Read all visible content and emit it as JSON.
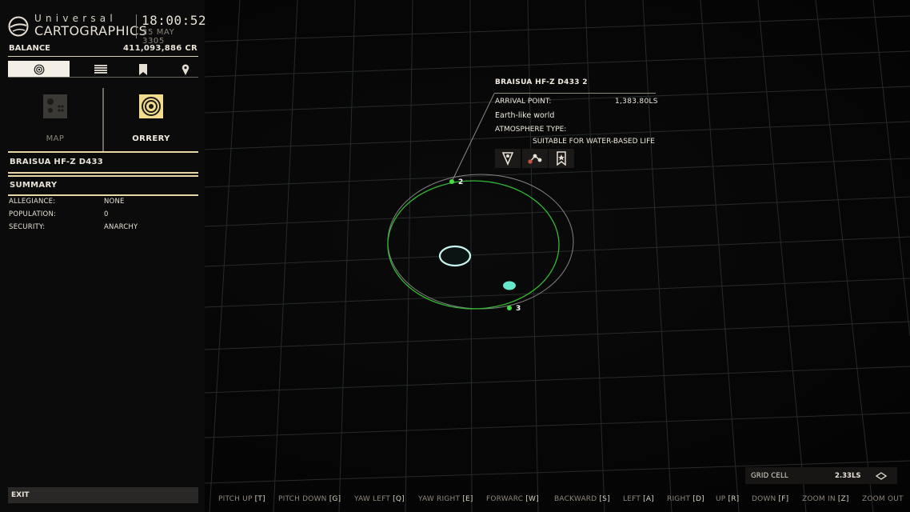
{
  "header": {
    "logo_top": "Universal",
    "logo_bottom": "CARTOGRAPHICS",
    "time": "18:00:52",
    "date": "25 MAY 3305"
  },
  "balance": {
    "label": "BALANCE",
    "value": "411,093,886 CR"
  },
  "tabs": [
    {
      "icon": "system-icon",
      "active": true
    },
    {
      "icon": "list-icon",
      "active": false
    },
    {
      "icon": "bookmark-icon",
      "active": false
    },
    {
      "icon": "pin-icon",
      "active": false
    }
  ],
  "views": {
    "map_label": "MAP",
    "orrery_label": "ORRERY",
    "selected": "ORRERY"
  },
  "body": {
    "name": "BRAISUA HF-Z D433"
  },
  "summary": {
    "heading": "SUMMARY",
    "rows": [
      {
        "label": "ALLEGIANCE:",
        "value": "NONE"
      },
      {
        "label": "POPULATION:",
        "value": "0"
      },
      {
        "label": "SECURITY:",
        "value": "ANARCHY"
      }
    ]
  },
  "exit_label": "EXIT",
  "tooltip": {
    "title": "BRAISUA HF-Z D433 2",
    "arrival_label": "ARRIVAL POINT:",
    "arrival_value": "1,383.80LS",
    "body_type": "Earth-like world",
    "atmosphere_label": "ATMOSPHERE TYPE:",
    "atmosphere_value": "SUITABLE FOR WATER-BASED LIFE",
    "icons": [
      "target-pin-icon",
      "route-icon",
      "bookmark-star-icon"
    ]
  },
  "planets": [
    {
      "label": "2"
    },
    {
      "label": "3"
    }
  ],
  "grid_cell": {
    "label": "GRID CELL",
    "value": "2.33LS"
  },
  "controls": [
    {
      "label": "PITCH UP",
      "key": "T"
    },
    {
      "label": "PITCH DOWN",
      "key": "G"
    },
    {
      "label": "YAW LEFT",
      "key": "Q"
    },
    {
      "label": "YAW RIGHT",
      "key": "E"
    },
    {
      "label": "FORWARC",
      "key": "W"
    },
    {
      "label": "BACKWARD",
      "key": "S"
    },
    {
      "label": "LEFT",
      "key": "A"
    },
    {
      "label": "RIGHT",
      "key": "D"
    },
    {
      "label": "UP",
      "key": "R"
    },
    {
      "label": "DOWN",
      "key": "F"
    },
    {
      "label": "ZOOM IN",
      "key": "Z"
    },
    {
      "label": "ZOOM OUT",
      "key": ""
    }
  ],
  "colors": {
    "accent": "#e7d6a6",
    "orbit_green": "#3fc53f",
    "star_cyan": "#bff5ee",
    "planet_teal": "#66e6cc",
    "grid": "#2c3132"
  }
}
